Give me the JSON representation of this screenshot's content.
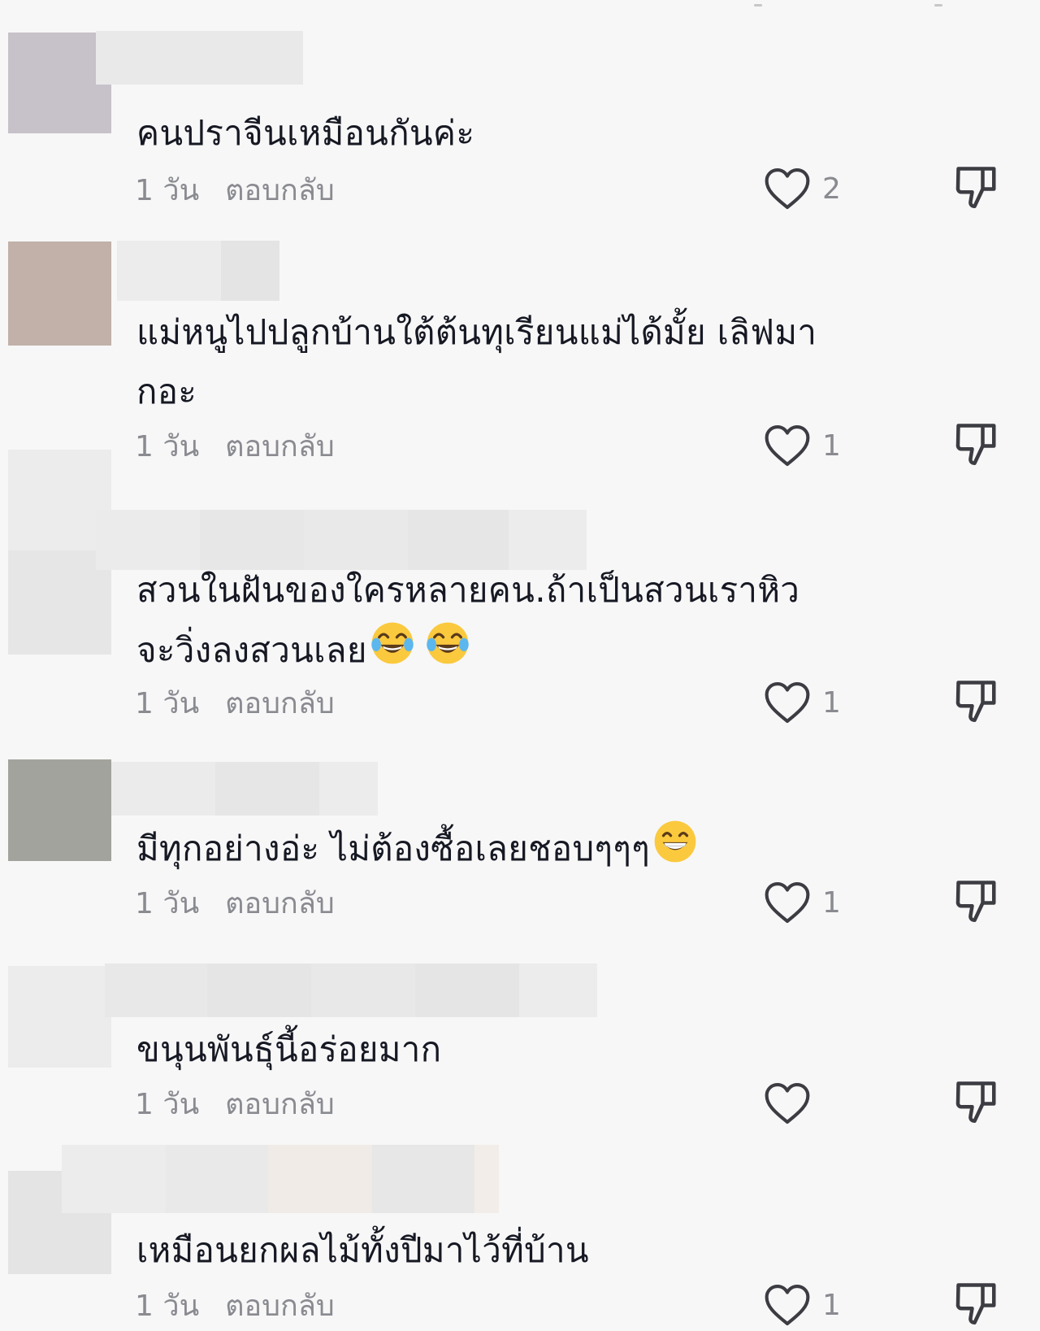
{
  "colors": {
    "background": "#f7f7f7",
    "text": "#161823",
    "secondary": "#8a8b91",
    "icon": "#3c3c43"
  },
  "comments": [
    {
      "text": "คนปราจีนเหมือนกันค่ะ",
      "time": "1 วัน",
      "reply_label": "ตอบกลับ",
      "like_count": "2",
      "icons": {
        "like": "heart-outline-icon",
        "dislike": "thumbs-down-outline-icon"
      }
    },
    {
      "text_line1": "แม่หนูไปปลูกบ้านใต้ต้นทุเรียนแม่ได้มั้ย เลิฟมา",
      "text_line2": "กอะ",
      "time": "1 วัน",
      "reply_label": "ตอบกลับ",
      "like_count": "1",
      "icons": {
        "like": "heart-outline-icon",
        "dislike": "thumbs-down-outline-icon"
      }
    },
    {
      "text_line1": "สวนในฝันของใครหลายคน.ถ้าเป็นสวนเราหิว",
      "text_line2": "จะวิ่งลงสวนเลย",
      "emojis": [
        "😂",
        "😂"
      ],
      "time": "1 วัน",
      "reply_label": "ตอบกลับ",
      "like_count": "1",
      "icons": {
        "like": "heart-outline-icon",
        "dislike": "thumbs-down-outline-icon"
      }
    },
    {
      "text": "มีทุกอย่างอ่ะ ไม่ต้องซื้อเลยชอบๆๆๆ",
      "emojis": [
        "😁"
      ],
      "time": "1 วัน",
      "reply_label": "ตอบกลับ",
      "like_count": "1",
      "icons": {
        "like": "heart-outline-icon",
        "dislike": "thumbs-down-outline-icon"
      }
    },
    {
      "text": "ขนุนพันธุ์นี้อร่อยมาก",
      "time": "1 วัน",
      "reply_label": "ตอบกลับ",
      "like_count": "",
      "icons": {
        "like": "heart-outline-icon",
        "dislike": "thumbs-down-outline-icon"
      }
    },
    {
      "text": "เหมือนยกผลไม้ทั้งปีมาไว้ที่บ้าน",
      "time": "1 วัน",
      "reply_label": "ตอบกลับ",
      "like_count": "1",
      "icons": {
        "like": "heart-outline-icon",
        "dislike": "thumbs-down-outline-icon"
      }
    }
  ]
}
